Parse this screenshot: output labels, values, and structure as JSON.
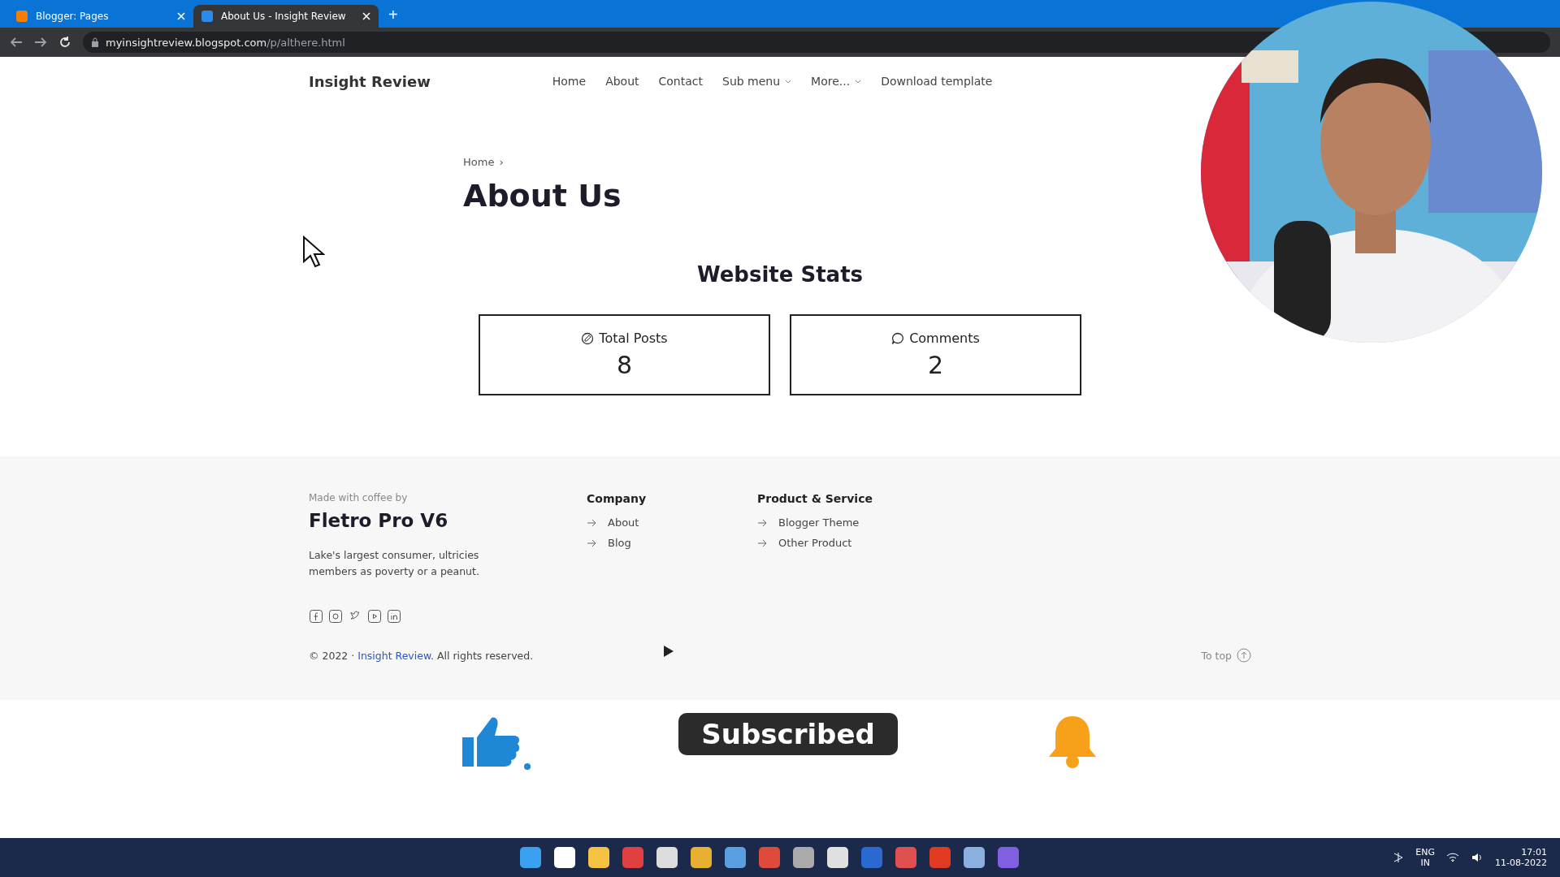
{
  "browser": {
    "tabs": [
      {
        "title": "Blogger: Pages",
        "selected": false
      },
      {
        "title": "About Us - Insight Review",
        "selected": true
      }
    ],
    "new_tab": "+",
    "url_host": "myinsightreview.blogspot.com",
    "url_path": "/p/althere.html"
  },
  "site": {
    "logo": "Insight Review",
    "nav": [
      {
        "label": "Home",
        "has_menu": false
      },
      {
        "label": "About",
        "has_menu": false
      },
      {
        "label": "Contact",
        "has_menu": false
      },
      {
        "label": "Sub menu",
        "has_menu": true
      },
      {
        "label": "More...",
        "has_menu": true
      },
      {
        "label": "Download template",
        "has_menu": false
      }
    ]
  },
  "page": {
    "breadcrumb": "Home",
    "breadcrumb_sep": "›",
    "title": "About Us",
    "stats_heading": "Website Stats",
    "stats": [
      {
        "kind": "posts",
        "label": "Total Posts",
        "value": "8"
      },
      {
        "kind": "comments",
        "label": "Comments",
        "value": "2"
      }
    ]
  },
  "footer": {
    "made_with": "Made with coffee by",
    "brand": "Fletro Pro V6",
    "description": "Lake's largest consumer, ultricies members as poverty or a peanut.",
    "columns": [
      {
        "heading": "Company",
        "links": [
          "About",
          "Blog"
        ]
      },
      {
        "heading": "Product & Service",
        "links": [
          "Blogger Theme",
          "Other Product"
        ]
      }
    ],
    "copyright": "© 2022 · ",
    "copyright_link": "Insight Review",
    "copyright_rest": ". All rights reserved.",
    "to_top": "To top"
  },
  "overlay": {
    "subscribe": "Subscribed"
  },
  "taskbar": {
    "lang": "ENG",
    "region": "IN",
    "time": "17:01",
    "date": "11-08-2022"
  }
}
